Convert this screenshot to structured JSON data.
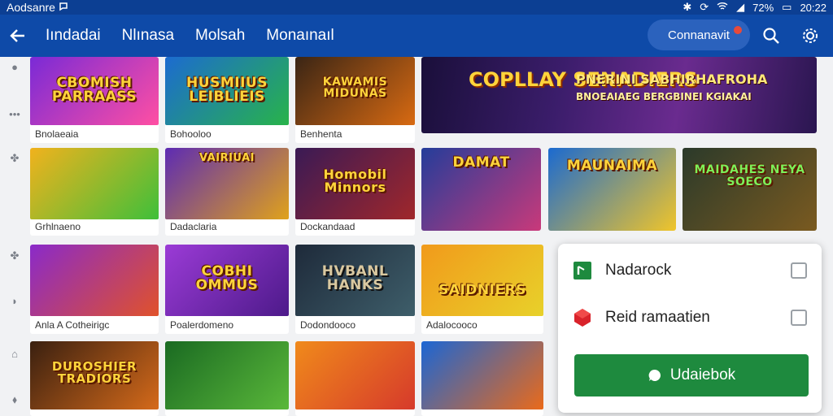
{
  "status_bar": {
    "carrier": "Aodsanre",
    "battery": "72%",
    "time": "20:22"
  },
  "app_bar": {
    "tabs": [
      "Iındadai",
      "Nlınasa",
      "Molsah",
      "Monaınaıl"
    ],
    "connect_label": "Connanavit"
  },
  "row1": [
    {
      "thumb_title": "CBOMISH PARRAASS",
      "label": "Bnolaeaia",
      "bg": "#7a2ad6"
    },
    {
      "thumb_title": "HUSMIIUS LEIBLIEIS",
      "label": "Bohooloo",
      "bg": "#1c6bd0"
    },
    {
      "thumb_title": "KAWAMIS MIDUNAS",
      "label": "Benhenta",
      "bg": "#d86a12"
    }
  ],
  "feature": {
    "logo": "COPLLAY SENADIERS",
    "headline1": "PNERINI SABHIRHAFROHA",
    "headline2": "BNOEAIAEG BERGBINEI KGIAKAI"
  },
  "row2": [
    {
      "thumb_title": "",
      "label": "Grhlnaeno",
      "bg": "#f1b21d"
    },
    {
      "thumb_title": "VAIRIUAI",
      "label": "Dadaclaria",
      "bg": "#5d2bb3"
    },
    {
      "thumb_title": "Homobil Minnors",
      "label": "Dockandaad",
      "bg": "#3a1a55"
    },
    {
      "thumb_title": "DAMAT",
      "label": "",
      "bg": "#243d9a"
    },
    {
      "thumb_title": "MAUNAIMA",
      "label": "",
      "bg": "#1b6ad0"
    },
    {
      "thumb_title": "MAIDAHES NEYA SOECO",
      "label": "",
      "bg": "#2b3a2a"
    }
  ],
  "row3": [
    {
      "thumb_title": "",
      "label": "Anla A Cotheirigc",
      "bg": "#8a2ac9"
    },
    {
      "thumb_title": "COBHI OMMUS",
      "label": "Poalerdomeno",
      "bg": "#9b3bd6"
    },
    {
      "thumb_title": "HVBANL HANKS",
      "label": "Dodondooco",
      "bg": "#1e2a3a"
    },
    {
      "thumb_title": "SAIDNIERS",
      "label": "Adalocooco",
      "bg": "#f19a1b"
    }
  ],
  "row4": [
    {
      "thumb_title": "DUROSHIER TRADIORS",
      "label": "",
      "bg": "#3a2010"
    },
    {
      "thumb_title": "",
      "label": "",
      "bg": "#1a6a22"
    },
    {
      "thumb_title": "",
      "label": "",
      "bg": "#f08a1b"
    },
    {
      "thumb_title": "",
      "label": "",
      "bg": "#1b66d4"
    }
  ],
  "popup": {
    "item1": "Nadarock",
    "item2": "Reid ramaatien",
    "button_label": "Udaiebok"
  }
}
